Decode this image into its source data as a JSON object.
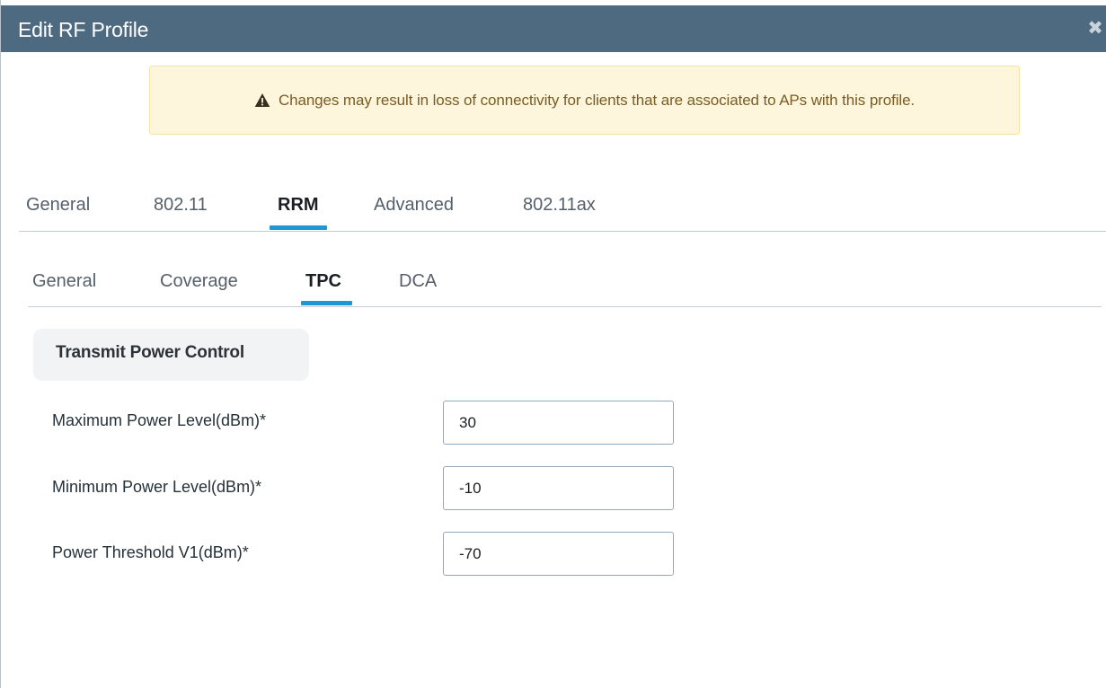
{
  "dialog": {
    "title": "Edit RF Profile",
    "close_glyph": "✖"
  },
  "alert": {
    "icon": "warning-triangle-icon",
    "message": "Changes may result in loss of connectivity for clients that are associated to APs with this profile."
  },
  "tabs": {
    "items": [
      {
        "label": "General"
      },
      {
        "label": "802.11"
      },
      {
        "label": "RRM"
      },
      {
        "label": "Advanced"
      },
      {
        "label": "802.11ax"
      }
    ],
    "active": "RRM"
  },
  "subtabs": {
    "items": [
      {
        "label": "General"
      },
      {
        "label": "Coverage"
      },
      {
        "label": "TPC"
      },
      {
        "label": "DCA"
      }
    ],
    "active": "TPC"
  },
  "tpc": {
    "section_title": "Transmit Power Control",
    "fields": [
      {
        "label": "Maximum Power Level(dBm)*",
        "value": "30"
      },
      {
        "label": "Minimum Power Level(dBm)*",
        "value": "-10"
      },
      {
        "label": "Power Threshold V1(dBm)*",
        "value": "-70"
      }
    ]
  },
  "colors": {
    "titlebar": "#4e6a80",
    "accent": "#1e97d4",
    "alert_bg": "#fdf6dd",
    "alert_text": "#7a5c23"
  }
}
